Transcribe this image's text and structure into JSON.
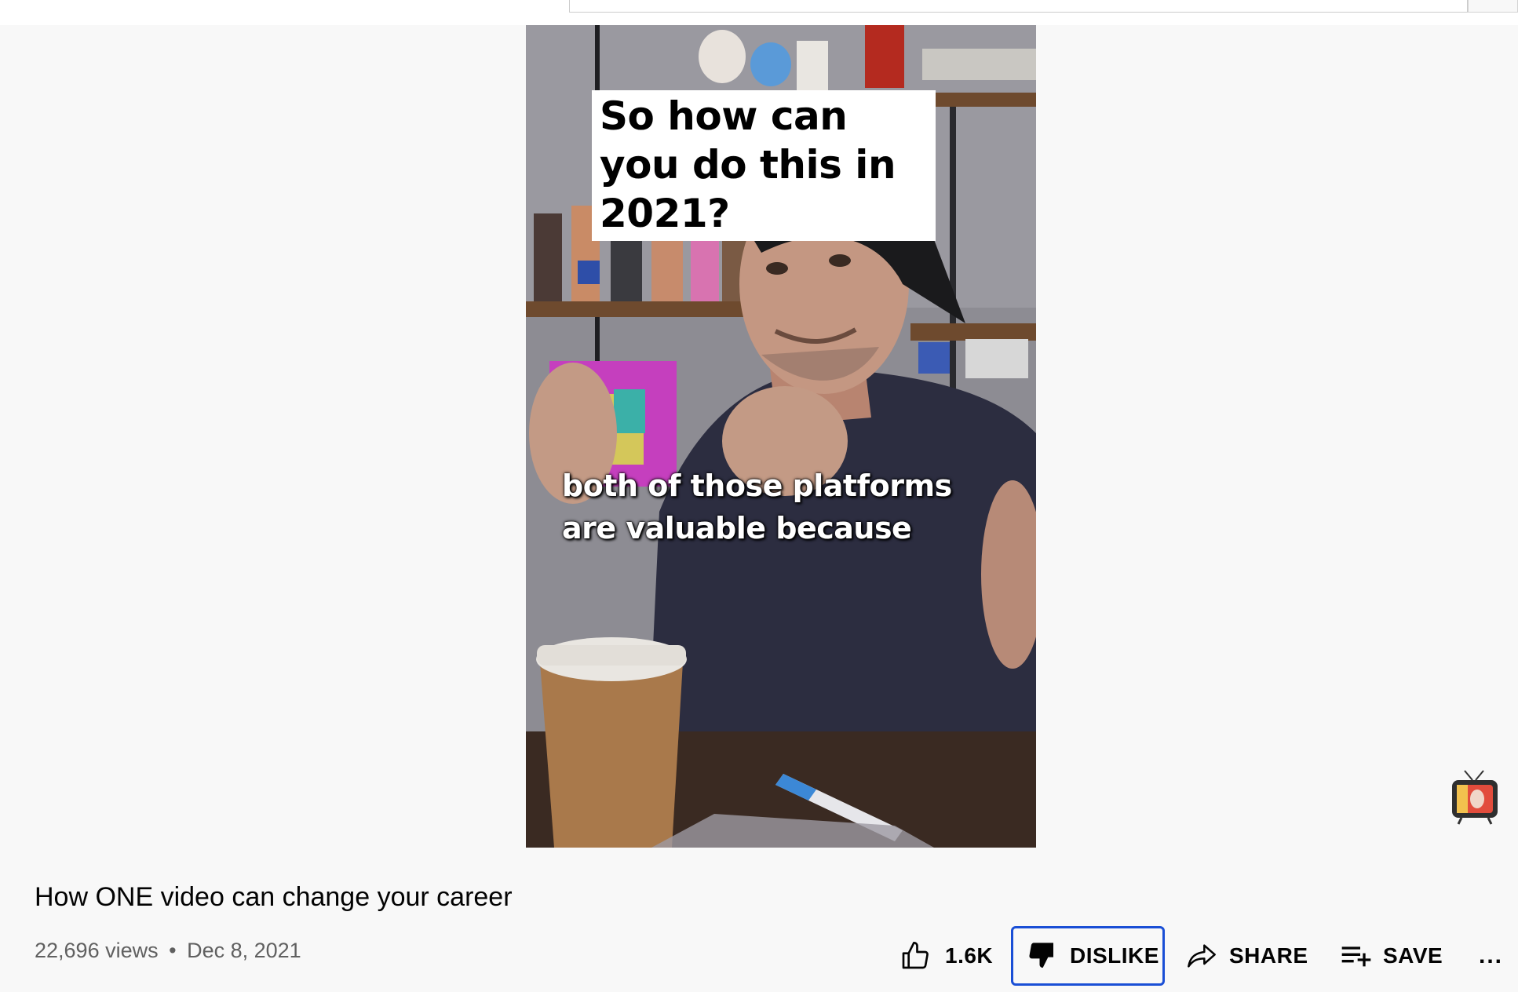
{
  "video": {
    "caption_top": "So how can you do this in 2021?",
    "caption_bottom": "both of those platforms are valuable because"
  },
  "watermark_icon": "channel-tv-icon",
  "meta": {
    "title": "How ONE video can change your career",
    "views": "22,696 views",
    "separator": "•",
    "date": "Dec 8, 2021"
  },
  "actions": {
    "like_count": "1.6K",
    "like_icon": "thumbs-up-icon",
    "dislike_label": "DISLIKE",
    "dislike_icon": "thumbs-down-icon",
    "share_label": "SHARE",
    "share_icon": "share-arrow-icon",
    "save_label": "SAVE",
    "save_icon": "playlist-add-icon",
    "more_label": "..."
  },
  "colors": {
    "page_bg": "#f8f8f8",
    "focus_outline": "#1a4fd6",
    "secondary_text": "#606060"
  }
}
